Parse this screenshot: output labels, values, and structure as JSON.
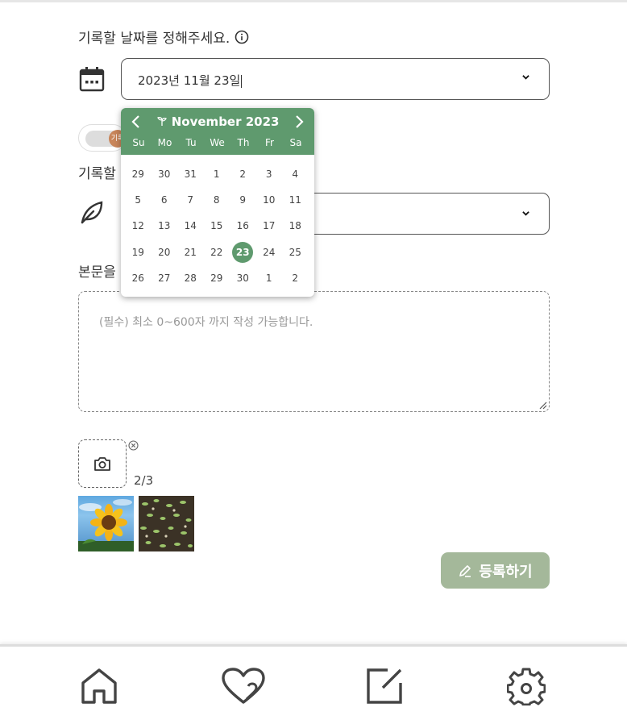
{
  "form": {
    "date_label": "기록할 날짜를 정해주세요.",
    "date_value": "2023년 11월 23일",
    "category_label": "기록할",
    "body_label": "본문을",
    "body_placeholder": "(필수) 최소 0~600자 까지 작성 가능합니다.",
    "toggle_label": "기록",
    "photo_count": "2/3",
    "submit_label": "등록하기"
  },
  "calendar": {
    "title": "November 2023",
    "weekdays": [
      "Su",
      "Mo",
      "Tu",
      "We",
      "Th",
      "Fr",
      "Sa"
    ],
    "days": [
      [
        "29",
        "30",
        "31",
        "1",
        "2",
        "3",
        "4"
      ],
      [
        "5",
        "6",
        "7",
        "8",
        "9",
        "10",
        "11"
      ],
      [
        "12",
        "13",
        "14",
        "15",
        "16",
        "17",
        "18"
      ],
      [
        "19",
        "20",
        "21",
        "22",
        "23",
        "24",
        "25"
      ],
      [
        "26",
        "27",
        "28",
        "29",
        "30",
        "1",
        "2"
      ]
    ],
    "selected": "23"
  },
  "colors": {
    "accent": "#5f9a6e",
    "submit_bg": "#a4b89a",
    "toggle_knob": "#c8855a"
  },
  "nav": {
    "items": [
      "home-icon",
      "heart-icon",
      "edit-icon",
      "settings-icon"
    ]
  }
}
